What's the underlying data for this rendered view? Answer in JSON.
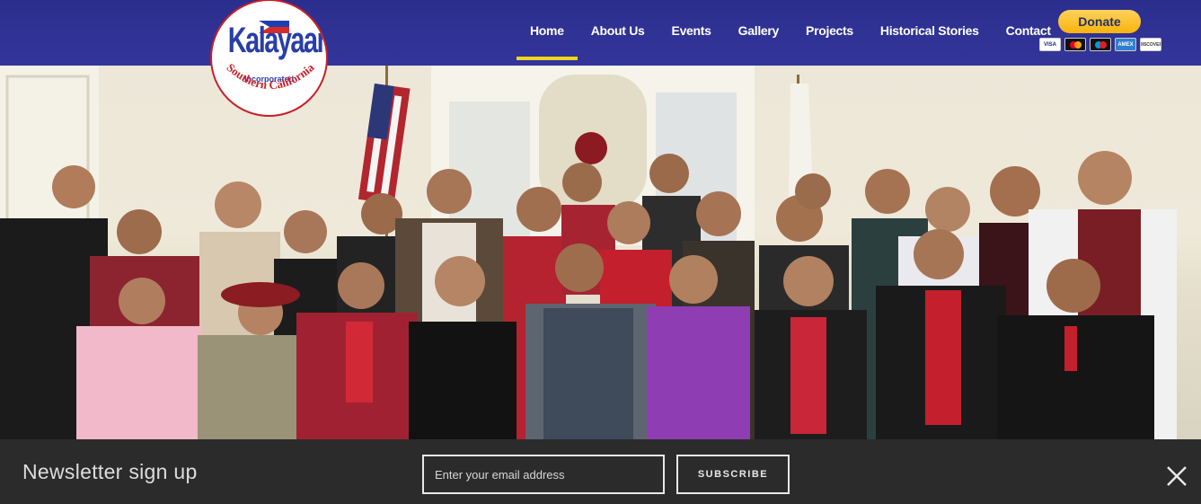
{
  "brand": {
    "name": "Kalayaan",
    "suffix": "Incorporated",
    "region": "Southern California"
  },
  "nav": {
    "items": [
      {
        "label": "Home",
        "active": true
      },
      {
        "label": "About Us"
      },
      {
        "label": "Events"
      },
      {
        "label": "Gallery"
      },
      {
        "label": "Projects"
      },
      {
        "label": "Historical Stories"
      },
      {
        "label": "Contact"
      }
    ]
  },
  "donate": {
    "label": "Donate",
    "cards": [
      "VISA",
      "mastercard",
      "maestro",
      "AMEX",
      "DISCOVER"
    ]
  },
  "hero": {
    "icon": "group-photo"
  },
  "newsletter": {
    "title": "Newsletter sign up",
    "email_placeholder": "Enter your email address",
    "subscribe_label": "SUBSCRIBE",
    "close_icon": "close-icon"
  },
  "colors": {
    "header": "#2f3194",
    "nav_active": "#f1d51c",
    "donate": "#fbc02d",
    "newsletter_bg": "#2b2b2b"
  }
}
